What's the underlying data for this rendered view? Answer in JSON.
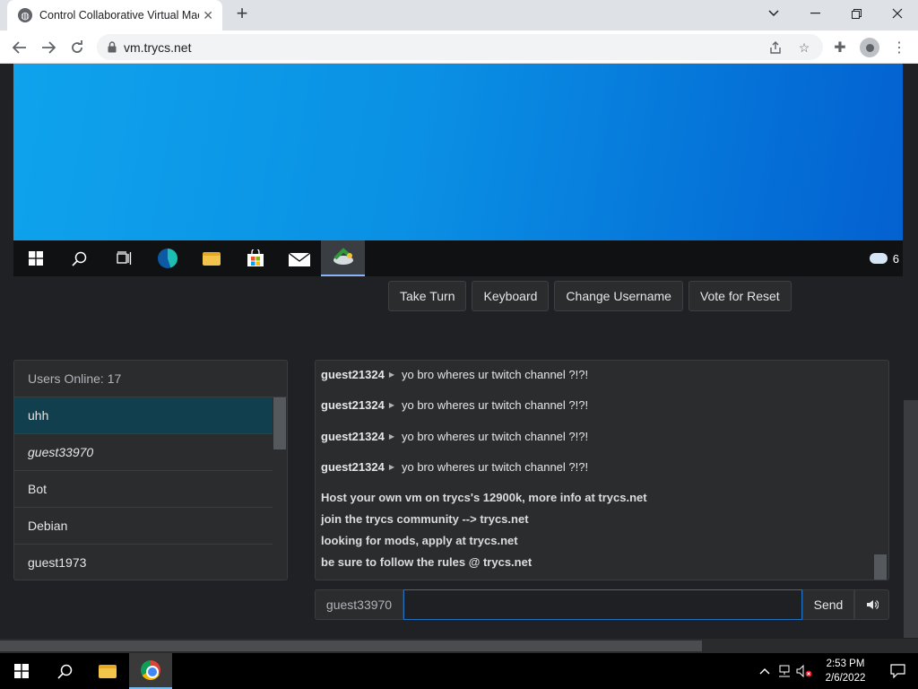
{
  "browser": {
    "tab_title": "Control Collaborative Virtual Machines",
    "url": "vm.trycs.net",
    "icons": {
      "favicon": "globe-icon",
      "tab_close": "close-icon",
      "new_tab": "plus-icon",
      "back": "back-arrow-icon",
      "forward": "forward-arrow-icon",
      "reload": "reload-icon",
      "lock": "lock-icon",
      "share": "share-icon",
      "bookmark": "star-icon",
      "extensions": "puzzle-icon",
      "profile": "profile-icon",
      "menu": "kebab-menu-icon"
    }
  },
  "vm": {
    "weather_text": "6"
  },
  "actions": {
    "take_turn": "Take Turn",
    "keyboard": "Keyboard",
    "change_username": "Change Username",
    "vote_reset": "Vote for Reset"
  },
  "users": {
    "header": "Users Online: 17",
    "list": [
      {
        "name": "uhh"
      },
      {
        "name": "guest33970"
      },
      {
        "name": "Bot"
      },
      {
        "name": "Debian"
      },
      {
        "name": "guest1973"
      }
    ]
  },
  "chat": {
    "messages": [
      {
        "user": "guest21324",
        "text": "yo bro wheres ur twitch channel ?!?!"
      },
      {
        "user": "guest21324",
        "text": "yo bro wheres ur twitch channel ?!?!"
      },
      {
        "user": "guest21324",
        "text": "yo bro wheres ur twitch channel ?!?!"
      },
      {
        "user": "guest21324",
        "text": "yo bro wheres ur twitch channel ?!?!"
      }
    ],
    "system": [
      "Host your own vm on trycs's 12900k, more info at trycs.net",
      "join the trycs community --> trycs.net",
      "looking for mods, apply at trycs.net",
      "be sure to follow the rules @ trycs.net"
    ],
    "username": "guest33970",
    "input_value": "",
    "send_label": "Send"
  },
  "taskbar": {
    "time": "2:53 PM",
    "date": "2/6/2022"
  },
  "colors": {
    "accent": "#1f6fc2",
    "selected_user": "#123f4d",
    "vm_desktop": "#0a90e4"
  }
}
